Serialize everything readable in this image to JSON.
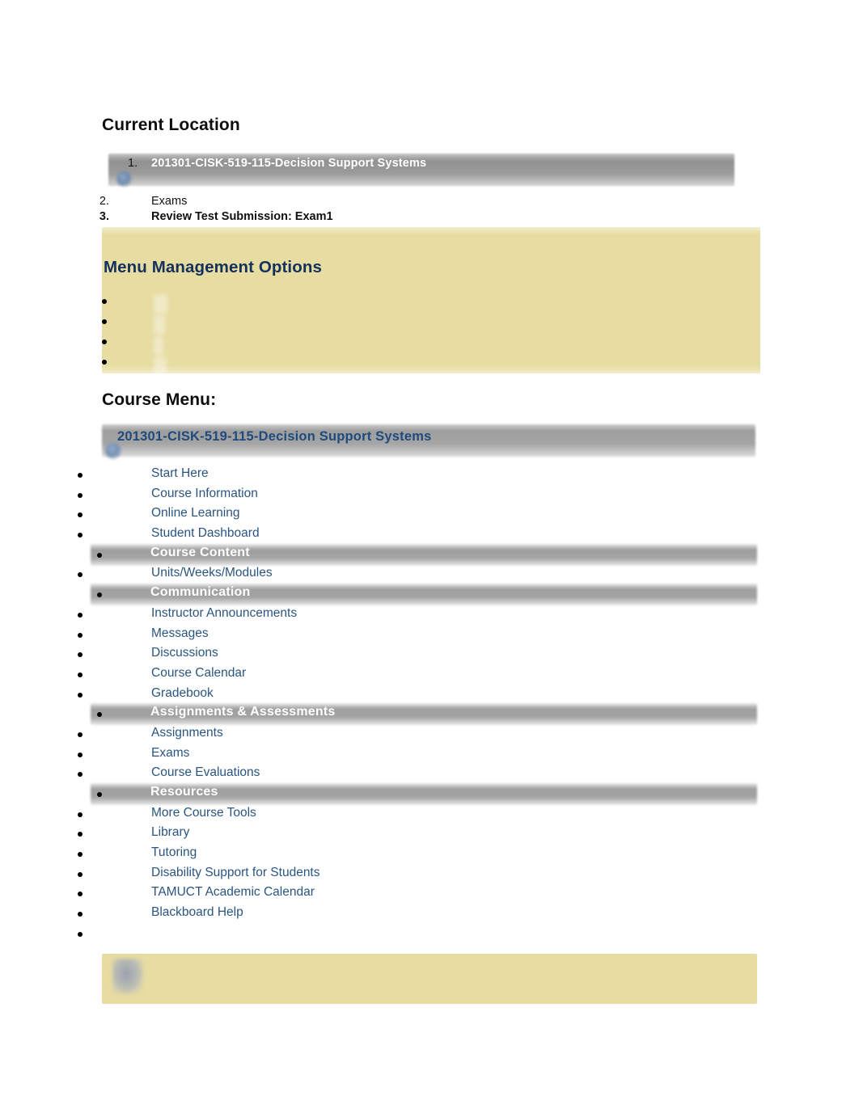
{
  "document": {
    "title": "Review Test Submission: Exam1"
  },
  "current_location": {
    "heading": "Current Location",
    "breadcrumb": [
      {
        "number": "1.",
        "label": "201301-CISK-519-115-Decision Support Systems",
        "style": "highlighted"
      },
      {
        "number": "2.",
        "label": "Exams",
        "style": "plain"
      },
      {
        "number": "3.",
        "label": "Review Test Submission: Exam1",
        "style": "bold"
      }
    ]
  },
  "menu_management": {
    "heading": "Menu Management Options",
    "options": [
      {
        "label": ""
      },
      {
        "label": ""
      },
      {
        "label": ""
      },
      {
        "label": ""
      }
    ]
  },
  "course_menu": {
    "heading": "Course Menu:",
    "course_title": "201301-CISK-519-115-Decision Support Systems",
    "items": [
      {
        "label": "Start Here",
        "type": "link"
      },
      {
        "label": "Course Information",
        "type": "link"
      },
      {
        "label": "Online Learning",
        "type": "link"
      },
      {
        "label": "Student Dashboard",
        "type": "link"
      },
      {
        "label": "Course Content",
        "type": "section"
      },
      {
        "label": "Units/Weeks/Modules",
        "type": "link"
      },
      {
        "label": "Communication",
        "type": "section"
      },
      {
        "label": "Instructor Announcements",
        "type": "link"
      },
      {
        "label": "Messages",
        "type": "link"
      },
      {
        "label": "Discussions",
        "type": "link"
      },
      {
        "label": "Course Calendar",
        "type": "link"
      },
      {
        "label": "Gradebook",
        "type": "link"
      },
      {
        "label": "Assignments & Assessments",
        "type": "section"
      },
      {
        "label": "Assignments",
        "type": "link"
      },
      {
        "label": "Exams",
        "type": "link"
      },
      {
        "label": "Course Evaluations",
        "type": "link"
      },
      {
        "label": "Resources",
        "type": "section"
      },
      {
        "label": "More Course Tools",
        "type": "link"
      },
      {
        "label": "Library",
        "type": "link"
      },
      {
        "label": "Tutoring",
        "type": "link"
      },
      {
        "label": "Disability Support for Students",
        "type": "link"
      },
      {
        "label": "TAMUCT Academic Calendar",
        "type": "link"
      },
      {
        "label": "Blackboard Help",
        "type": "link"
      },
      {
        "label": "",
        "type": "link"
      }
    ]
  },
  "footer_panel": {
    "label": ""
  },
  "colors": {
    "panel_yellow": "#e7dca1",
    "link_blue": "#2a5580",
    "heading_navy": "#14305c",
    "course_title_blue": "#1f4a7d",
    "bar_grey": "#9c9c9c",
    "text_black": "#111111"
  }
}
